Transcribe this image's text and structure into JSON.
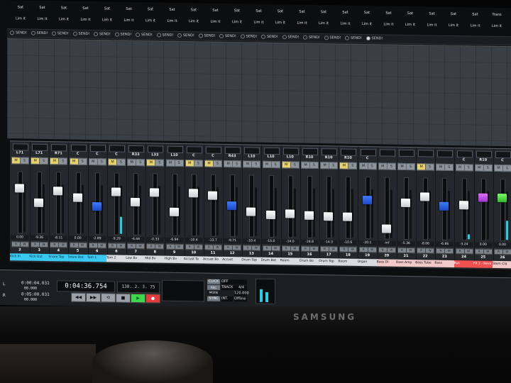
{
  "top_grid": {
    "row1": [
      "Sat",
      "Sat",
      "Sat",
      "Sat",
      "Sat",
      "Sat",
      "Sat",
      "Sat",
      "Sat",
      "Sat",
      "Sat",
      "Sat",
      "Sat",
      "Sat",
      "Sat",
      "Sat",
      "Sat",
      "Sat",
      "Sat",
      "Sat",
      "Sat",
      "Sat",
      "Trans"
    ],
    "row2": [
      "Lim it",
      "Lim it",
      "Lim it",
      "Lim it",
      "Lim it",
      "Lim it",
      "Lim it",
      "Lim it",
      "Lim it",
      "Lim it",
      "Lim it",
      "Lim it",
      "Lim it",
      "Lim it",
      "Lim it",
      "Lim it",
      "Lim it",
      "Lim it",
      "Lim it",
      "Lim it",
      "Lim it",
      "Lim it",
      "Lim it"
    ]
  },
  "send_label": "SEND!",
  "send_count": 18,
  "send_active_index": 17,
  "channels": [
    {
      "pan": "L71",
      "m": true,
      "vol": "0.00",
      "num": "2",
      "label": "Kick In",
      "label_style": "cyan",
      "fader": 0.78,
      "color": "white",
      "meter": 0
    },
    {
      "pan": "L71",
      "m": true,
      "vol": "-9.36",
      "num": "3",
      "label": "Kick Out",
      "label_style": "cyan",
      "fader": 0.52,
      "color": "white",
      "meter": 0
    },
    {
      "pan": "R71",
      "m": true,
      "vol": "-8.11",
      "num": "4",
      "label": "Snare Top",
      "label_style": "cyan",
      "fader": 0.74,
      "color": "white",
      "meter": 0
    },
    {
      "pan": "C",
      "m": true,
      "vol": "0.00",
      "num": "5",
      "label": "Snare Bot",
      "label_style": "cyan",
      "fader": 0.62,
      "color": "white",
      "meter": 0
    },
    {
      "pan": "C",
      "m": false,
      "vol": "-2.89",
      "num": "6",
      "label": "Tom 1",
      "label_style": "cyan",
      "fader": 0.48,
      "color": "blue",
      "meter": 0
    },
    {
      "pan": "C",
      "m": true,
      "vol": "-9.29",
      "num": "6",
      "label": "Tom 2",
      "label_style": "",
      "fader": 0.74,
      "color": "white",
      "meter": 0.35
    },
    {
      "pan": "R33",
      "m": false,
      "vol": "-6.44",
      "num": "7",
      "label": "Low Bv",
      "label_style": "",
      "fader": 0.56,
      "color": "white",
      "meter": 0
    },
    {
      "pan": "L33",
      "m": true,
      "vol": "-0.33",
      "num": "8",
      "label": "Mid Bv",
      "label_style": "",
      "fader": 0.74,
      "color": "white",
      "meter": 0
    },
    {
      "pan": "L10",
      "m": false,
      "vol": "-6.94",
      "num": "9",
      "label": "High Bv",
      "label_style": "",
      "fader": 0.4,
      "color": "white",
      "meter": 0
    },
    {
      "pan": "C",
      "m": true,
      "vol": "-10.4",
      "num": "10",
      "label": "Accust Ta",
      "label_style": "",
      "fader": 0.74,
      "color": "white",
      "meter": 0
    },
    {
      "pan": "C",
      "m": true,
      "vol": "-13.7",
      "num": "11",
      "label": "Accust Bo",
      "label_style": "",
      "fader": 0.7,
      "color": "white",
      "meter": 0
    },
    {
      "pan": "R43",
      "m": false,
      "vol": "-9.71",
      "num": "12",
      "label": "Accust",
      "label_style": "",
      "fader": 0.52,
      "color": "blue",
      "meter": 0
    },
    {
      "pan": "L10",
      "m": false,
      "vol": "-10.4",
      "num": "13",
      "label": "Drum Top",
      "label_style": "",
      "fader": 0.42,
      "color": "white",
      "meter": 0
    },
    {
      "pan": "L10",
      "m": false,
      "vol": "-15.0",
      "num": "14",
      "label": "Drum Bot",
      "label_style": "",
      "fader": 0.38,
      "color": "white",
      "meter": 0
    },
    {
      "pan": "L10",
      "m": true,
      "vol": "-14.0",
      "num": "15",
      "label": "Room",
      "label_style": "",
      "fader": 0.4,
      "color": "white",
      "meter": 0
    },
    {
      "pan": "R10",
      "m": false,
      "vol": "-19.8",
      "num": "16",
      "label": "Drum Bo",
      "label_style": "",
      "fader": 0.38,
      "color": "white",
      "meter": 0
    },
    {
      "pan": "R10",
      "m": false,
      "vol": "-14.3",
      "num": "17",
      "label": "Drum Top",
      "label_style": "",
      "fader": 0.36,
      "color": "white",
      "meter": 0
    },
    {
      "pan": "R10",
      "m": true,
      "vol": "-10.6",
      "num": "18",
      "label": "Room",
      "label_style": "",
      "fader": 0.36,
      "color": "white",
      "meter": 0
    },
    {
      "pan": "C",
      "m": false,
      "vol": "-20.1",
      "num": "19",
      "label": "Organ",
      "label_style": "",
      "fader": 0.66,
      "color": "blue",
      "meter": 0
    },
    {
      "pan": "",
      "m": false,
      "vol": "-inf",
      "num": "20",
      "label": "Bass DI",
      "label_style": "pink",
      "fader": 0.16,
      "color": "white",
      "meter": 0
    },
    {
      "pan": "",
      "m": false,
      "vol": "-5.36",
      "num": "21",
      "label": "Bass Amp",
      "label_style": "pink",
      "fader": 0.62,
      "color": "white",
      "meter": 0
    },
    {
      "pan": "",
      "m": true,
      "vol": "-8.06",
      "num": "22",
      "label": "Bass Tube",
      "label_style": "pink",
      "fader": 0.74,
      "color": "white",
      "meter": 0
    },
    {
      "pan": "",
      "m": false,
      "vol": "-6.86",
      "num": "23",
      "label": "Bass",
      "label_style": "pink",
      "fader": 0.58,
      "color": "blue",
      "meter": 0
    },
    {
      "pan": "C",
      "m": false,
      "vol": "-3.24",
      "num": "24",
      "label": "Bus",
      "label_style": "red",
      "fader": 0.6,
      "color": "white",
      "meter": 0.1
    },
    {
      "pan": "R19",
      "m": false,
      "vol": "0.00",
      "num": "25",
      "label": "FX 2 - Reve",
      "label_style": "red",
      "fader": 0.74,
      "color": "purple",
      "meter": 0
    },
    {
      "pan": "C",
      "m": false,
      "vol": "0.00",
      "num": "26",
      "label": "Stem Cla",
      "label_style": "pink",
      "fader": 0.74,
      "color": "green",
      "meter": 0.4
    }
  ],
  "m_label": "M",
  "s_label": "S",
  "r_label": "R",
  "w_label": "W",
  "transport": {
    "left_time": "0:00:04.031",
    "left_sub": "00.000",
    "left_time2": "0:05:00.031",
    "left_sub2": "00.000",
    "main_time": "0:04:36.754",
    "bbt": "138. 2. 3. 75",
    "rewind_label": "◀◀",
    "ff_label": "▶▶",
    "stop_label": "■",
    "play_label": "▶",
    "rec_label": "●",
    "sync": {
      "click_k": "CLICK",
      "click_v": "OFF",
      "rec_k": "REC MODE",
      "track_k": "TRACK",
      "track_v": "4/4",
      "tempo_v": "120.000",
      "sync_k": "SYNC",
      "int_v": "INT.",
      "offline_v": "Offline"
    }
  },
  "brand": "SAMSUNG"
}
